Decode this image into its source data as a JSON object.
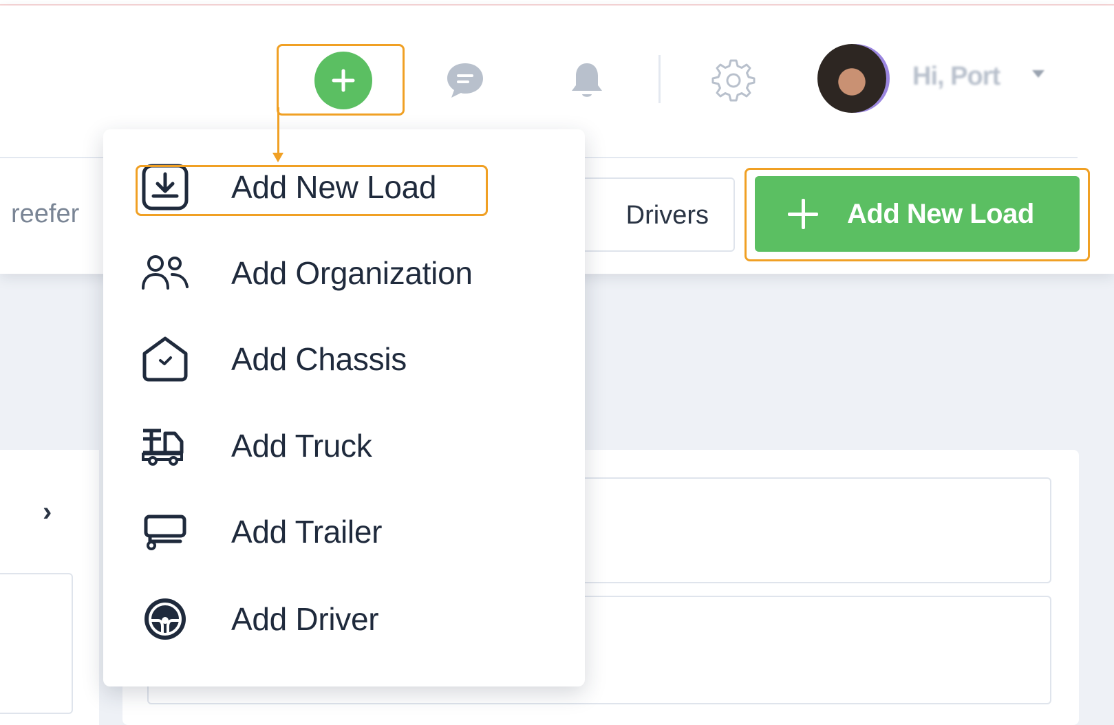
{
  "header": {
    "user_greeting": "Hi, Port",
    "icons": [
      "plus-icon",
      "chat-icon",
      "bell-icon",
      "gear-icon",
      "chevron-down-icon"
    ]
  },
  "toolbar": {
    "reefer_label": "reefer",
    "drivers_tab_label": "Drivers",
    "add_new_load_button_label": "Add New Load"
  },
  "quick_add_menu": {
    "items": [
      {
        "label": "Add New Load",
        "icon": "download-icon"
      },
      {
        "label": "Add Organization",
        "icon": "users-icon"
      },
      {
        "label": "Add Chassis",
        "icon": "chassis-icon"
      },
      {
        "label": "Add Truck",
        "icon": "truck-icon"
      },
      {
        "label": "Add Trailer",
        "icon": "trailer-icon"
      },
      {
        "label": "Add Driver",
        "icon": "steering-wheel-icon"
      }
    ]
  },
  "content": {
    "chevron_icon": "chevron-right-icon"
  },
  "colors": {
    "accent_green": "#5bbf62",
    "highlight_orange": "#f0a024",
    "text_dark": "#1f2a3c"
  }
}
